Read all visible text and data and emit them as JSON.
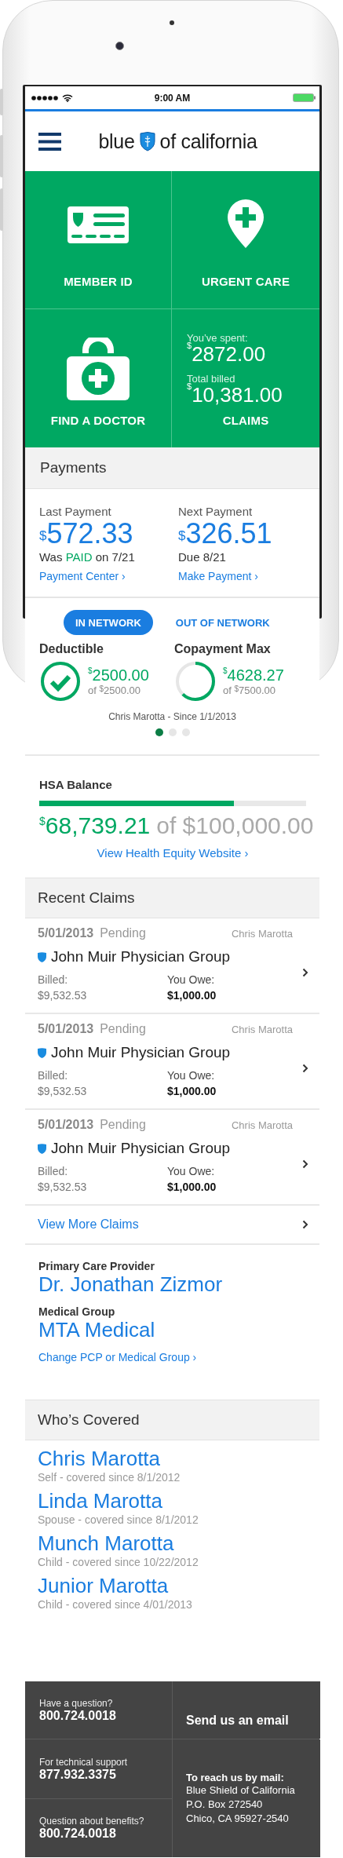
{
  "status_bar": {
    "time": "9:00 AM"
  },
  "header": {
    "logo_left": "blue",
    "logo_right": "of california"
  },
  "tiles": [
    {
      "kind": "member_id",
      "label": "MEMBER ID"
    },
    {
      "kind": "urgent_care",
      "label": "URGENT CARE"
    },
    {
      "kind": "find_doctor",
      "label": "FIND A DOCTOR"
    },
    {
      "kind": "claims",
      "label": "CLAIMS",
      "spent_label": "You’ve spent:",
      "spent": {
        "currency": "$",
        "value": "2872.00"
      },
      "billed_label": "Total billed",
      "billed": {
        "currency": "$",
        "value": "10,381.00"
      }
    }
  ],
  "payments": {
    "title": "Payments",
    "columns": [
      {
        "label": "Last Payment",
        "amount": {
          "currency": "$",
          "value": "572.33"
        },
        "note": [
          {
            "text": "Was",
            "highlight": false
          },
          {
            "text": "PAID",
            "highlight": true
          },
          {
            "text": "on 7/21",
            "highlight": false
          }
        ],
        "link": "Payment Center ›"
      },
      {
        "label": "Next Payment",
        "amount": {
          "currency": "$",
          "value": "326.51"
        },
        "note": [
          {
            "text": "Due 8/21",
            "highlight": false
          }
        ],
        "link": "Make Payment ›"
      }
    ]
  },
  "network": {
    "tabs": [
      {
        "label": "IN NETWORK",
        "selected": true
      },
      {
        "label": "OUT OF NETWORK",
        "selected": false
      }
    ],
    "meters": [
      {
        "title": "Deductible",
        "level": 1,
        "amount": {
          "currency": "$",
          "value": "2500.00"
        },
        "of": {
          "prefix": "of",
          "currency": "$",
          "value": "2500.00"
        }
      },
      {
        "title": "Copayment Max",
        "level": 0.62,
        "amount": {
          "currency": "$",
          "value": "4628.27"
        },
        "of": {
          "prefix": "of",
          "currency": "$",
          "value": "7500.00"
        }
      }
    ],
    "caption": "Chris Marotta - Since 1/1/2013",
    "pages": [
      {
        "selected": true
      },
      {
        "selected": false
      },
      {
        "selected": false
      }
    ]
  },
  "hsa": {
    "title": "HSA Balance",
    "level": 0.73,
    "amount": {
      "currency": "$",
      "value": "68,739.21"
    },
    "total": "of $100,000.00",
    "link": "View Health Equity Website ›"
  },
  "claims": {
    "title": "Recent Claims",
    "items": [
      {
        "date": "5/01/2013",
        "status": "Pending",
        "member": "Chris Marotta",
        "provider": "John Muir Physician Group",
        "billed_label": "Billed:",
        "billed": "$9,532.53",
        "owe_label": "You Owe:",
        "owe": "$1,000.00"
      },
      {
        "date": "5/01/2013",
        "status": "Pending",
        "member": "Chris Marotta",
        "provider": "John Muir Physician Group",
        "billed_label": "Billed:",
        "billed": "$9,532.53",
        "owe_label": "You Owe:",
        "owe": "$1,000.00"
      },
      {
        "date": "5/01/2013",
        "status": "Pending",
        "member": "Chris Marotta",
        "provider": "John Muir Physician Group",
        "billed_label": "Billed:",
        "billed": "$9,532.53",
        "owe_label": "You Owe:",
        "owe": "$1,000.00"
      }
    ],
    "more": "View More Claims"
  },
  "pcp": {
    "provider_label": "Primary Care Provider",
    "provider": "Dr. Jonathan Zizmor",
    "group_label": "Medical Group",
    "group": "MTA Medical",
    "link": "Change PCP or Medical Group ›"
  },
  "covered": {
    "title": "Who’s Covered",
    "members": [
      {
        "name": "Chris Marotta",
        "detail": "Self - covered since 8/1/2012"
      },
      {
        "name": "Linda Marotta",
        "detail": "Spouse - covered since 8/1/2012"
      },
      {
        "name": "Munch Marotta",
        "detail": "Child - covered since 10/22/2012"
      },
      {
        "name": "Junior Marotta",
        "detail": "Child - covered since 4/01/2013"
      }
    ]
  },
  "footer": {
    "phones": [
      {
        "label": "Have a question?",
        "value": "800.724.0018"
      },
      {
        "label": "For technical support",
        "value": "877.932.3375"
      },
      {
        "label": "Question about benefits?",
        "value": "800.724.0018"
      }
    ],
    "email": "Send us an email",
    "mail": {
      "title": "To reach us by mail:",
      "lines": [
        "Blue Shield of California",
        "P.O. Box 272540",
        "Chico, CA 95927-2540"
      ]
    }
  }
}
